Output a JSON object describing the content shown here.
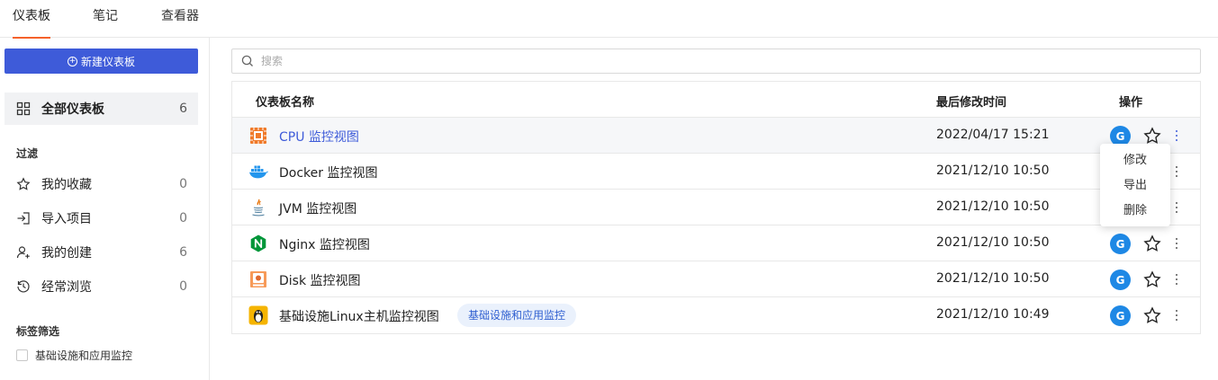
{
  "tabs": [
    {
      "label": "仪表板",
      "active": true
    },
    {
      "label": "笔记",
      "active": false
    },
    {
      "label": "查看器",
      "active": false
    }
  ],
  "sidebar": {
    "new_button": "新建仪表板",
    "all": {
      "label": "全部仪表板",
      "count": "6"
    },
    "filter_title": "过滤",
    "filters": [
      {
        "label": "我的收藏",
        "count": "0",
        "icon": "star-icon"
      },
      {
        "label": "导入项目",
        "count": "0",
        "icon": "import-icon"
      },
      {
        "label": "我的创建",
        "count": "6",
        "icon": "user-add-icon"
      },
      {
        "label": "经常浏览",
        "count": "0",
        "icon": "history-icon"
      }
    ],
    "tag_title": "标签筛选",
    "tags": [
      {
        "label": "基础设施和应用监控",
        "checked": false
      }
    ]
  },
  "search": {
    "placeholder": "搜索",
    "value": ""
  },
  "table": {
    "headers": {
      "name": "仪表板名称",
      "modified": "最后修改时间",
      "actions": "操作"
    },
    "rows": [
      {
        "name": "CPU 监控视图",
        "icon": "cpu-icon",
        "time": "2022/04/17 15:21",
        "avatar": "G",
        "tag": ""
      },
      {
        "name": "Docker 监控视图",
        "icon": "docker-icon",
        "time": "2021/12/10 10:50",
        "avatar": "G",
        "tag": ""
      },
      {
        "name": "JVM 监控视图",
        "icon": "java-icon",
        "time": "2021/12/10 10:50",
        "avatar": "G",
        "tag": ""
      },
      {
        "name": "Nginx 监控视图",
        "icon": "nginx-icon",
        "time": "2021/12/10 10:50",
        "avatar": "G",
        "tag": ""
      },
      {
        "name": "Disk 监控视图",
        "icon": "disk-icon",
        "time": "2021/12/10 10:50",
        "avatar": "G",
        "tag": ""
      },
      {
        "name": "基础设施Linux主机监控视图",
        "icon": "linux-icon",
        "time": "2021/12/10 10:49",
        "avatar": "G",
        "tag": "基础设施和应用监控"
      }
    ]
  },
  "menu": {
    "items": [
      "修改",
      "导出",
      "删除"
    ]
  },
  "colors": {
    "primary": "#3e5bd9",
    "tab_accent": "#f5612a",
    "avatar": "#1e88e5",
    "tag_bg": "#eaf1fc"
  }
}
